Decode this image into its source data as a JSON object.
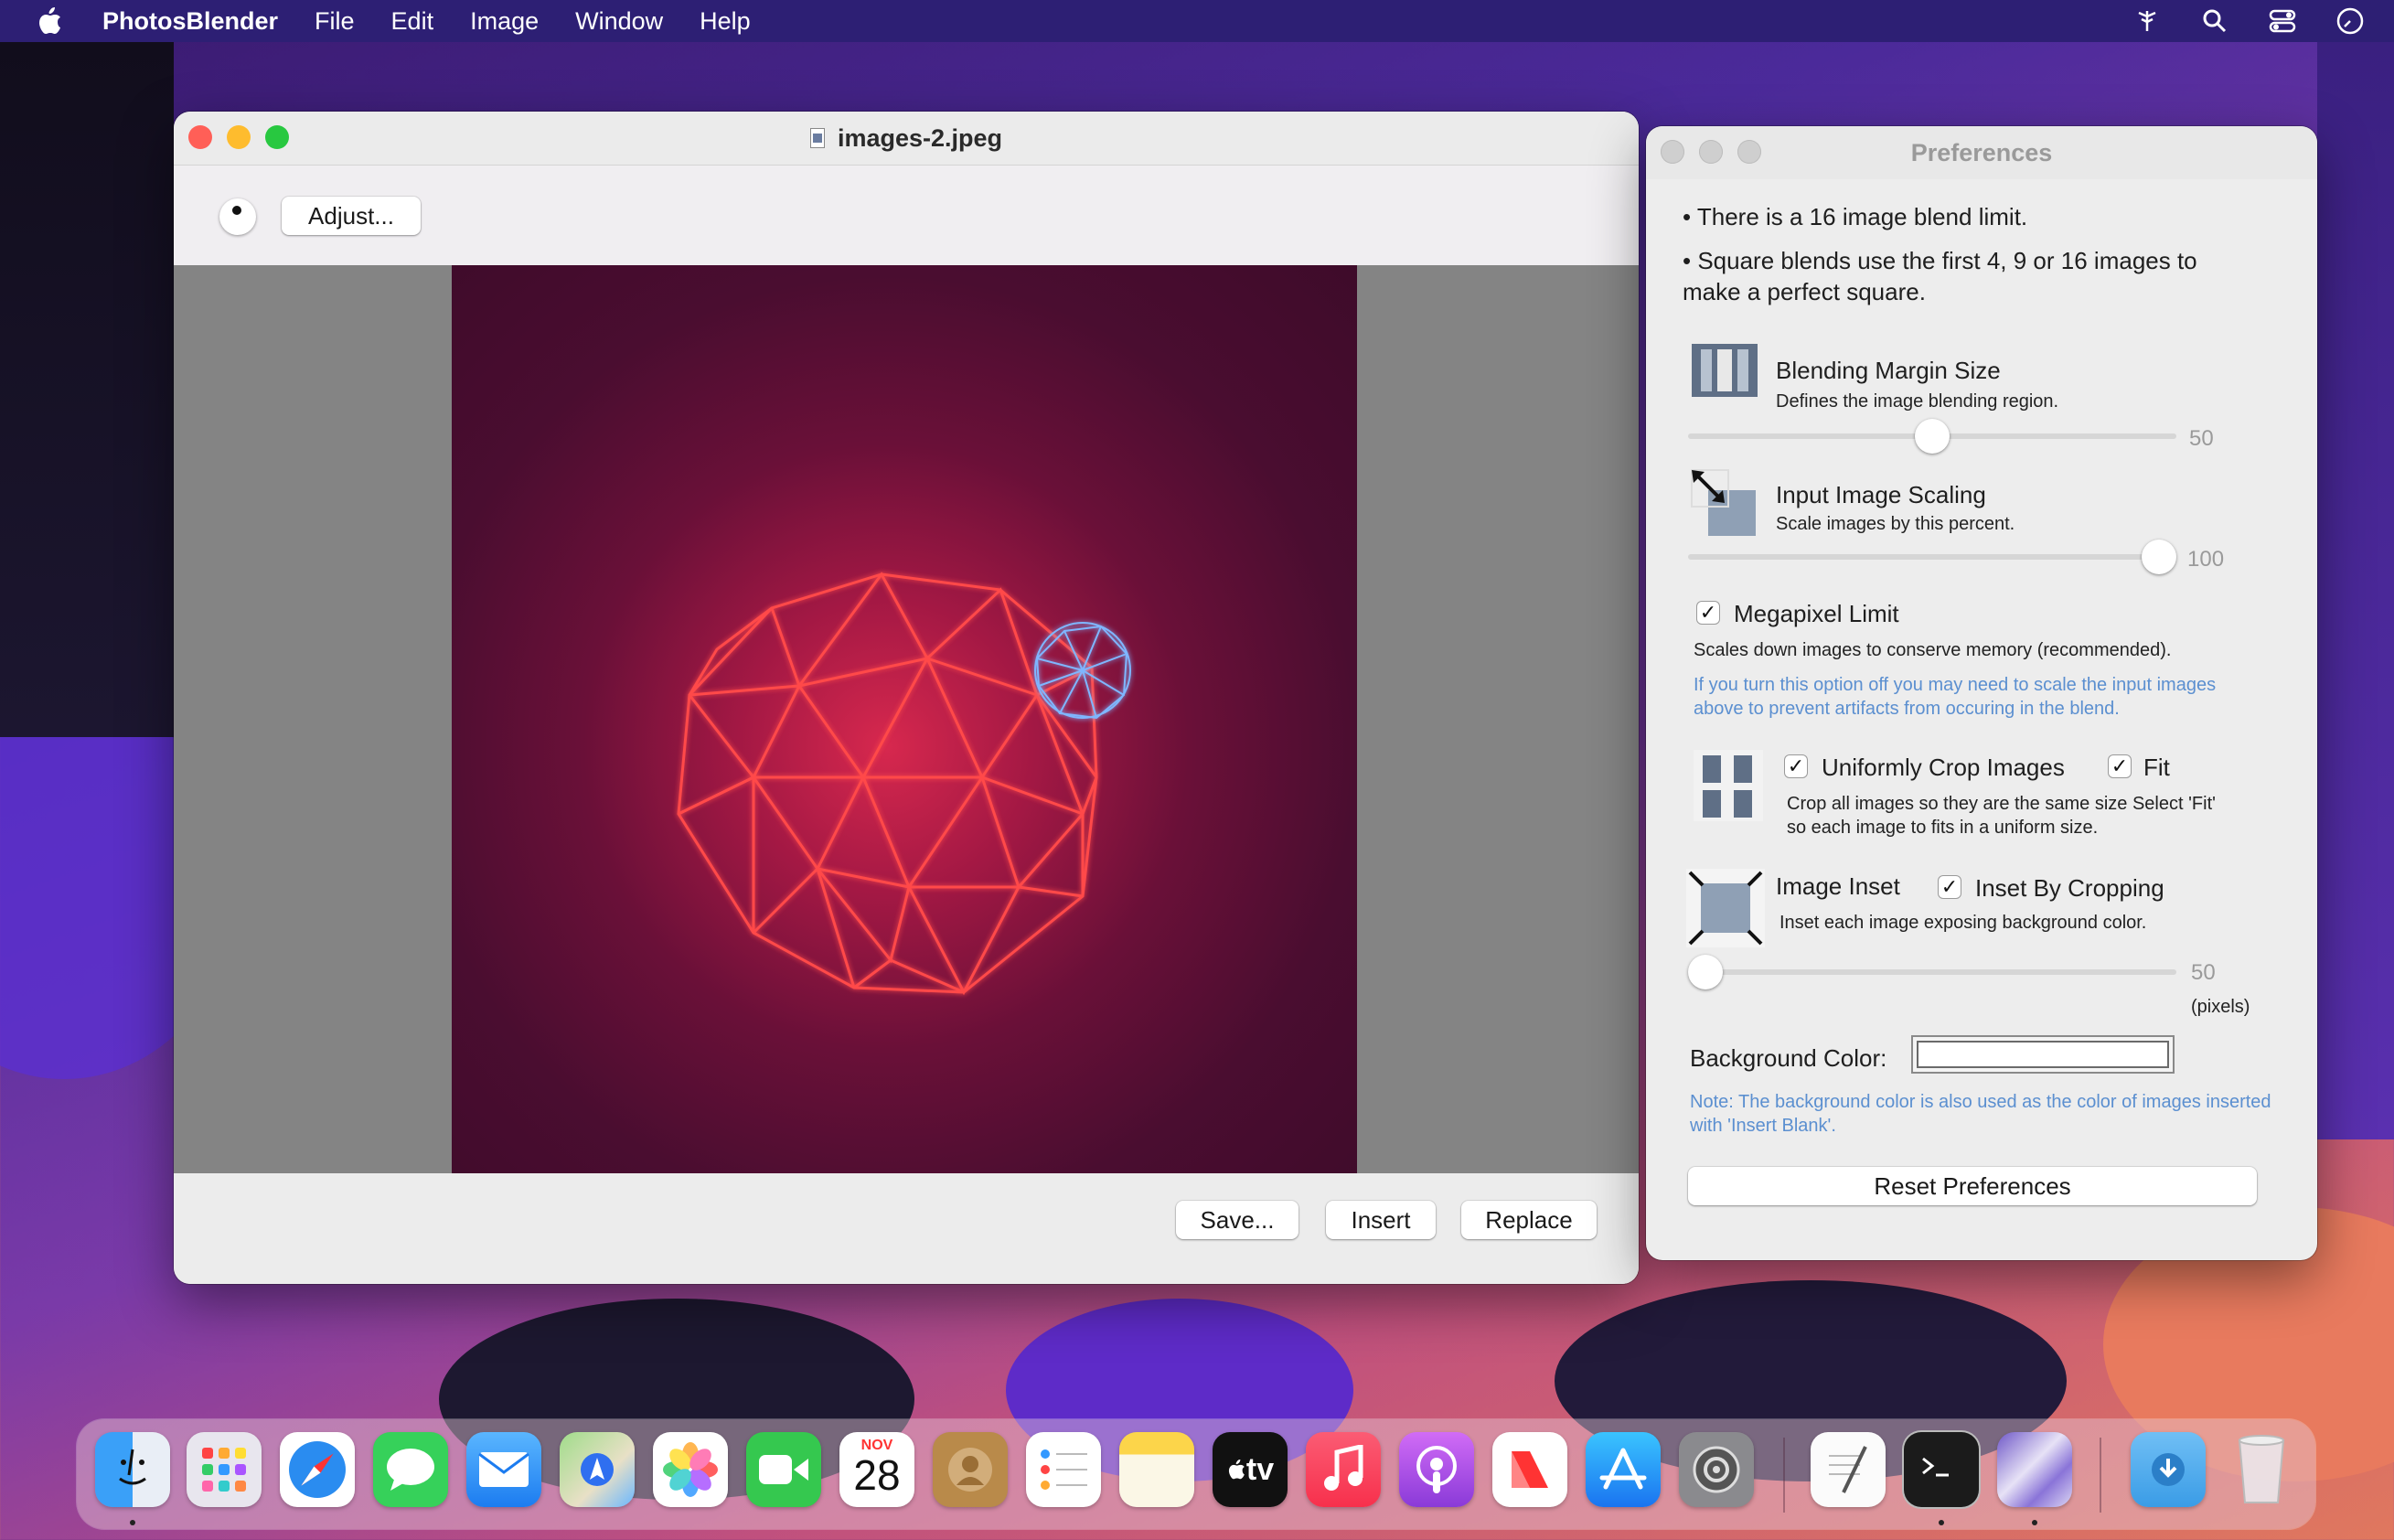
{
  "menubar": {
    "app_name": "PhotosBlender",
    "items": [
      "File",
      "Edit",
      "Image",
      "Window",
      "Help"
    ]
  },
  "main_window": {
    "title": "images-2.jpeg",
    "adjust_label": "Adjust...",
    "save_label": "Save...",
    "insert_label": "Insert",
    "replace_label": "Replace"
  },
  "preferences": {
    "title": "Preferences",
    "info_line_1": "• There is a 16 image blend limit.",
    "info_line_2a": "• Square blends use the first 4, 9 or 16 images to",
    "info_line_2b": "make a perfect square.",
    "blending_margin": {
      "title": "Blending Margin Size",
      "desc": "Defines the image blending region.",
      "value": "50",
      "fraction": 0.5
    },
    "input_scaling": {
      "title": "Input Image Scaling",
      "desc": "Scale images by this percent.",
      "value": "100",
      "fraction": 1.0
    },
    "megapixel": {
      "label": "Megapixel Limit",
      "checked": true,
      "desc": "Scales down images to conserve memory (recommended).",
      "note": "If you turn this option off you may need to scale the input images above to prevent artifacts from occuring in the blend."
    },
    "crop": {
      "label": "Uniformly Crop Images",
      "fit_label": "Fit",
      "checked": true,
      "fit_checked": true,
      "desc_1": "Crop all images so they are the same size Select 'Fit'",
      "desc_2": "so each image to fits in a uniform size."
    },
    "inset": {
      "label": "Image Inset",
      "by_cropping_label": "Inset By Cropping",
      "by_cropping_checked": true,
      "desc": "Inset each image exposing background color.",
      "value": "50",
      "unit": "(pixels)",
      "fraction": 0.0
    },
    "background_color_label": "Background Color:",
    "background_color_value": "#ffffff",
    "bg_note": "Note: The background color is also used as the color of images inserted with 'Insert Blank'.",
    "reset_label": "Reset Preferences"
  },
  "dock": {
    "calendar_month": "NOV",
    "calendar_day": "28",
    "tv_label": "tv",
    "apps": [
      "finder-icon",
      "launchpad-icon",
      "safari-icon",
      "messages-icon",
      "mail-icon",
      "maps-icon",
      "photos-icon",
      "facetime-icon",
      "calendar-icon",
      "contacts-icon",
      "reminders-icon",
      "notes-icon",
      "tv-icon",
      "music-icon",
      "podcasts-icon",
      "news-icon",
      "app-store-icon",
      "system-settings-icon",
      "textedit-icon",
      "terminal-icon",
      "photosblender-icon",
      "downloads-folder-icon",
      "trash-icon"
    ]
  },
  "colors": {
    "menubar": "#2d1f74",
    "close": "#ff5f57",
    "minimize": "#febc2e",
    "zoom": "#28c840",
    "note_blue": "#5b8fd0"
  }
}
